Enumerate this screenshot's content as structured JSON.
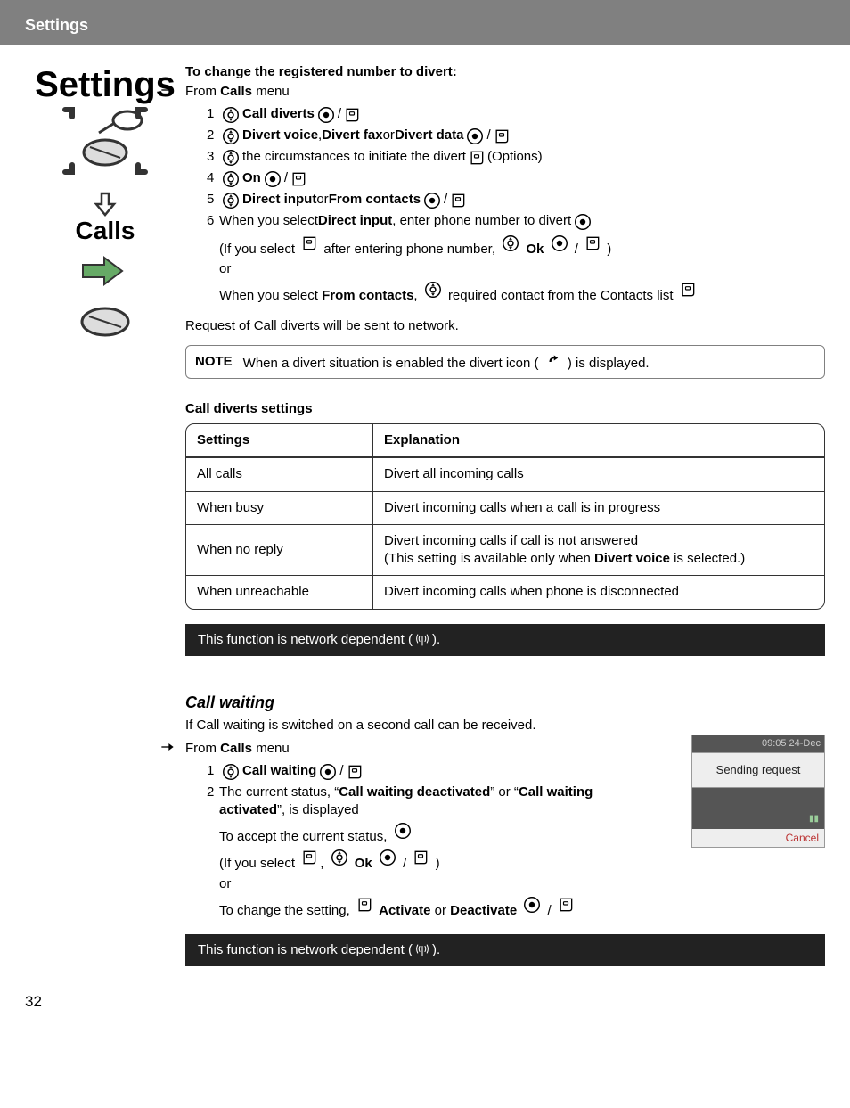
{
  "header": {
    "title": "Settings"
  },
  "leftcol": {
    "big": "Settings",
    "sub": "Calls"
  },
  "sec1": {
    "heading": "To change the registered number to divert:",
    "from_prefix": "From ",
    "from_bold": "Calls",
    "from_suffix": " menu",
    "steps": [
      {
        "n": "1",
        "bold": "Call diverts"
      },
      {
        "n": "2",
        "parts": [
          {
            "b": "Divert voice"
          },
          {
            "t": ", "
          },
          {
            "b": "Divert fax"
          },
          {
            "t": " or "
          },
          {
            "b": "Divert data"
          }
        ]
      },
      {
        "n": "3",
        "plain": " the circumstances to initiate the divert ",
        "trail": " (Options)"
      },
      {
        "n": "4",
        "bold": "On"
      },
      {
        "n": "5",
        "parts": [
          {
            "b": "Direct input"
          },
          {
            "t": " or "
          },
          {
            "b": "From contacts"
          }
        ]
      }
    ],
    "step6n": "6",
    "step6a_prefix": "When you select ",
    "step6a_bold": "Direct input",
    "step6a_suffix": ", enter phone number to divert ",
    "step6b_prefix": "(If you select ",
    "step6b_mid": " after entering phone number, ",
    "step6b_ok": "Ok",
    "step6b_end": ")",
    "or": "or",
    "step6c_prefix": "When you select ",
    "step6c_bold": "From contacts",
    "step6c_mid": ", ",
    "step6c_suffix": " required contact from the Contacts list ",
    "request_line": "Request of Call diverts will be sent to network.",
    "note_label": "NOTE",
    "note_text_pre": "When a divert situation is enabled the divert icon (",
    "note_text_post": ") is displayed."
  },
  "table": {
    "heading": "Call diverts settings",
    "col1": "Settings",
    "col2": "Explanation",
    "rows": [
      {
        "s": "All calls",
        "e_pre": "Divert all incoming calls",
        "e_bold": "",
        "e_post": ""
      },
      {
        "s": "When busy",
        "e_pre": "Divert incoming calls when a call is in progress",
        "e_bold": "",
        "e_post": ""
      },
      {
        "s": "When no reply",
        "e_pre": "Divert incoming calls if call is not answered\n(This setting is available only when ",
        "e_bold": "Divert voice",
        "e_post": " is selected.)"
      },
      {
        "s": "When unreachable",
        "e_pre": "Divert incoming calls when phone is disconnected",
        "e_bold": "",
        "e_post": ""
      }
    ]
  },
  "netbar": {
    "pre": "This function is network dependent (",
    "post": ")."
  },
  "callwaiting": {
    "heading": "Call waiting",
    "intro": "If Call waiting is switched on a second call can be received.",
    "from_prefix": "From ",
    "from_bold": "Calls",
    "from_suffix": " menu",
    "s1n": "1",
    "s1_bold": "Call waiting",
    "s2n": "2",
    "s2_a": "The current status, “",
    "s2_b": "Call waiting deactivated",
    "s2_c": "” or “",
    "s2_d": "Call waiting activated",
    "s2_e": "”, is displayed",
    "accept": "To accept the current status, ",
    "if_pre": "(If you select ",
    "if_ok": "Ok",
    "if_end": ")",
    "or": "or",
    "change_pre": "To change the setting, ",
    "change_a": "Activate",
    "change_or": " or ",
    "change_b": "Deactivate"
  },
  "phoneshot": {
    "top": "09:05 24-Dec",
    "mid": "Sending request",
    "bot": "Cancel"
  },
  "pagenum": "32"
}
